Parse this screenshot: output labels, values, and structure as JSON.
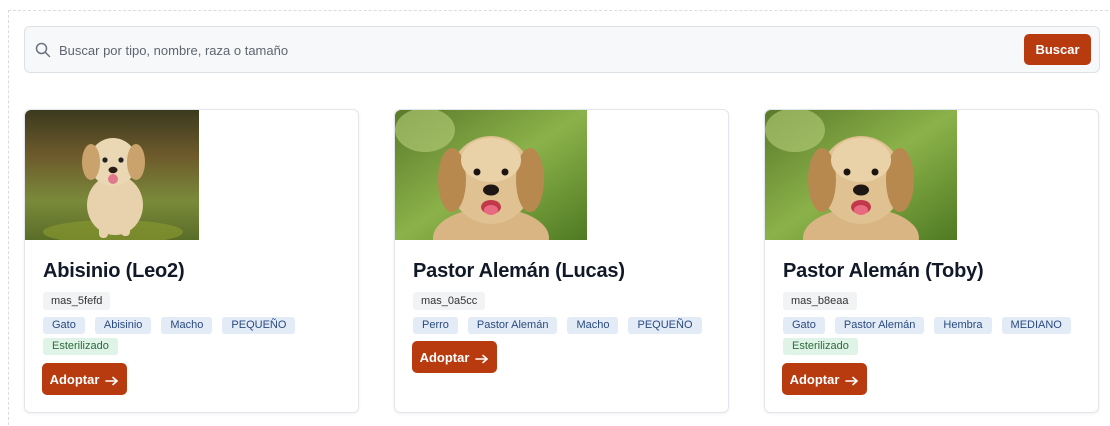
{
  "search": {
    "placeholder": "Buscar por tipo, nombre, raza o tamaño",
    "value": "",
    "button_label": "Buscar",
    "icon": "search-icon"
  },
  "colors": {
    "accent": "#b83a0f",
    "tag_blue_bg": "#e3ebf7",
    "tag_green_bg": "#dff3e6"
  },
  "pets": [
    {
      "name": "Abisinio (Leo2)",
      "id": "mas_5fefd",
      "tags": [
        "Gato",
        "Abisinio",
        "Macho",
        "PEQUEÑO"
      ],
      "status": "Esterilizado",
      "photo": "golden-puppy-running-photo",
      "adopt_label": "Adoptar"
    },
    {
      "name": "Pastor Alemán (Lucas)",
      "id": "mas_0a5cc",
      "tags": [
        "Perro",
        "Pastor Alemán",
        "Macho",
        "PEQUEÑO"
      ],
      "status": "",
      "photo": "golden-retriever-portrait-photo",
      "adopt_label": "Adoptar"
    },
    {
      "name": "Pastor Alemán (Toby)",
      "id": "mas_b8eaa",
      "tags": [
        "Gato",
        "Pastor Alemán",
        "Hembra",
        "MEDIANO"
      ],
      "status": "Esterilizado",
      "photo": "golden-retriever-portrait-photo",
      "adopt_label": "Adoptar"
    }
  ]
}
